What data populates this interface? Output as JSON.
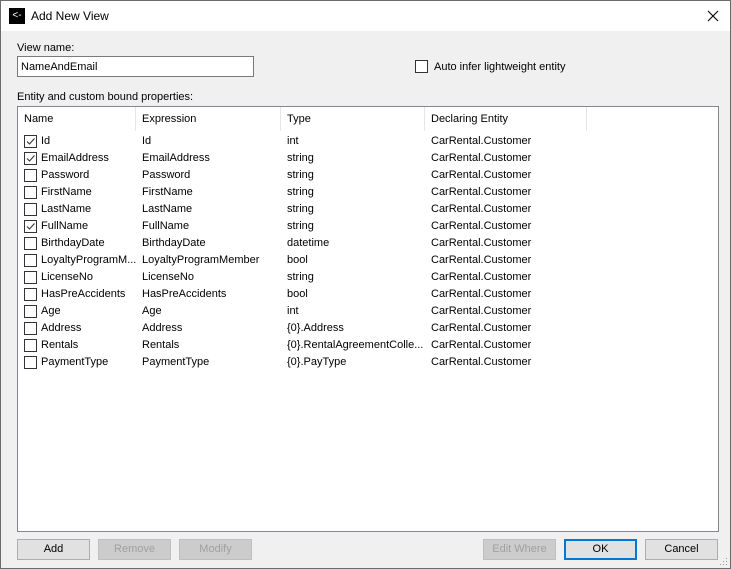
{
  "window": {
    "title": "Add New View",
    "app_icon": "back-arrow-icon",
    "close_icon": "close-icon"
  },
  "form": {
    "view_name_label": "View name:",
    "view_name_value": "NameAndEmail",
    "auto_infer_label": "Auto infer lightweight entity",
    "auto_infer_checked": false,
    "properties_label": "Entity and custom bound properties:"
  },
  "table": {
    "columns": [
      "Name",
      "Expression",
      "Type",
      "Declaring Entity"
    ],
    "rows": [
      {
        "checked": true,
        "name": "Id",
        "expression": "Id",
        "type": "int",
        "entity": "CarRental.Customer"
      },
      {
        "checked": true,
        "name": "EmailAddress",
        "expression": "EmailAddress",
        "type": "string",
        "entity": "CarRental.Customer"
      },
      {
        "checked": false,
        "name": "Password",
        "expression": "Password",
        "type": "string",
        "entity": "CarRental.Customer"
      },
      {
        "checked": false,
        "name": "FirstName",
        "expression": "FirstName",
        "type": "string",
        "entity": "CarRental.Customer"
      },
      {
        "checked": false,
        "name": "LastName",
        "expression": "LastName",
        "type": "string",
        "entity": "CarRental.Customer"
      },
      {
        "checked": true,
        "name": "FullName",
        "expression": "FullName",
        "type": "string",
        "entity": "CarRental.Customer"
      },
      {
        "checked": false,
        "name": "BirthdayDate",
        "expression": "BirthdayDate",
        "type": "datetime",
        "entity": "CarRental.Customer"
      },
      {
        "checked": false,
        "name": "LoyaltyProgramM...",
        "expression": "LoyaltyProgramMember",
        "type": "bool",
        "entity": "CarRental.Customer"
      },
      {
        "checked": false,
        "name": "LicenseNo",
        "expression": "LicenseNo",
        "type": "string",
        "entity": "CarRental.Customer"
      },
      {
        "checked": false,
        "name": "HasPreAccidents",
        "expression": "HasPreAccidents",
        "type": "bool",
        "entity": "CarRental.Customer"
      },
      {
        "checked": false,
        "name": "Age",
        "expression": "Age",
        "type": "int",
        "entity": "CarRental.Customer"
      },
      {
        "checked": false,
        "name": "Address",
        "expression": "Address",
        "type": "{0}.Address",
        "entity": "CarRental.Customer"
      },
      {
        "checked": false,
        "name": "Rentals",
        "expression": "Rentals",
        "type": "{0}.RentalAgreementColle...",
        "entity": "CarRental.Customer"
      },
      {
        "checked": false,
        "name": "PaymentType",
        "expression": "PaymentType",
        "type": "{0}.PayType",
        "entity": "CarRental.Customer"
      }
    ]
  },
  "buttons": {
    "add": "Add",
    "remove": "Remove",
    "modify": "Modify",
    "edit_where": "Edit Where",
    "ok": "OK",
    "cancel": "Cancel"
  },
  "colors": {
    "accent": "#0078d7",
    "disabled_text": "#a0a0a0"
  }
}
